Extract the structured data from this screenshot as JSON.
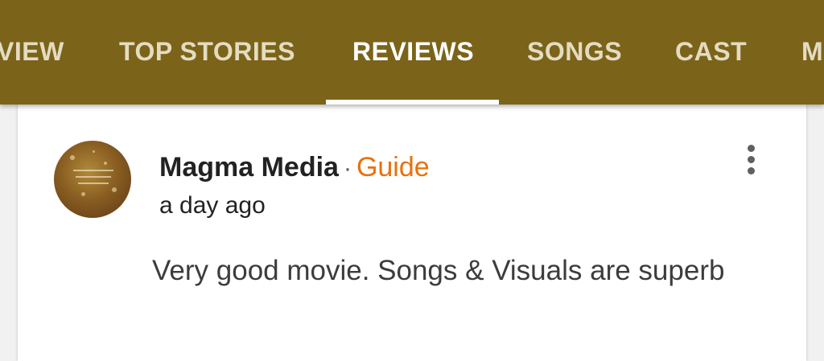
{
  "tabs": {
    "items": [
      {
        "label": "VIEW",
        "active": false
      },
      {
        "label": "TOP STORIES",
        "active": false
      },
      {
        "label": "REVIEWS",
        "active": true
      },
      {
        "label": "SONGS",
        "active": false
      },
      {
        "label": "CAST",
        "active": false
      },
      {
        "label": "M",
        "active": false
      }
    ]
  },
  "review": {
    "author": "Magma Media",
    "separator": "·",
    "badge": "Guide",
    "timestamp": "a day ago",
    "text": "Very good movie. Songs & Visuals are superb",
    "avatar_icon": "magma-media-avatar",
    "menu_icon": "more-vert-icon"
  },
  "colors": {
    "header_bg": "#7b6319",
    "tab_text": "#e4dcc2",
    "tab_active": "#ffffff",
    "badge": "#e8710a"
  }
}
